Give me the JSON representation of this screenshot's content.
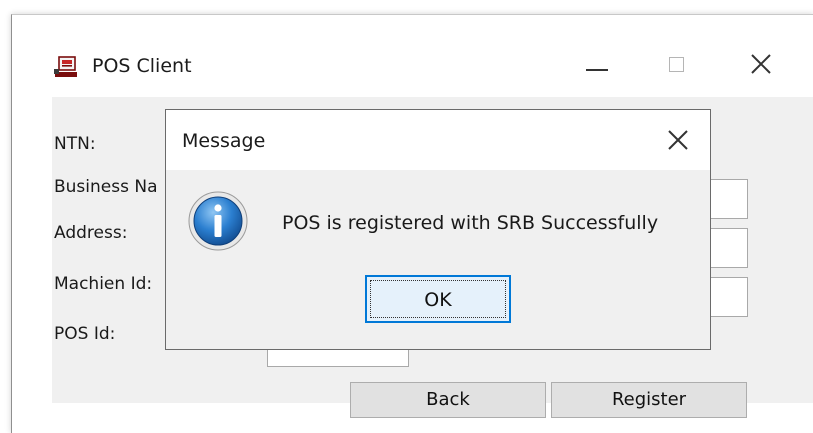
{
  "window": {
    "title": "POS Client",
    "icon": "pos-terminal-icon",
    "controls": {
      "minimize": "minimize-icon",
      "maximize": "maximize-icon",
      "close": "close-icon"
    }
  },
  "form": {
    "labels": {
      "ntn": "NTN:",
      "business_name": "Business Na",
      "address": "Address:",
      "machine_id": "Machien Id:",
      "pos_id": "POS Id:"
    },
    "buttons": {
      "back": "Back",
      "register": "Register"
    }
  },
  "dialog": {
    "title": "Message",
    "message": "POS is registered with SRB Successfully",
    "ok_label": "OK",
    "icon": "info-icon"
  },
  "colors": {
    "accent": "#0078d7",
    "client_bg": "#f0f0f0"
  }
}
